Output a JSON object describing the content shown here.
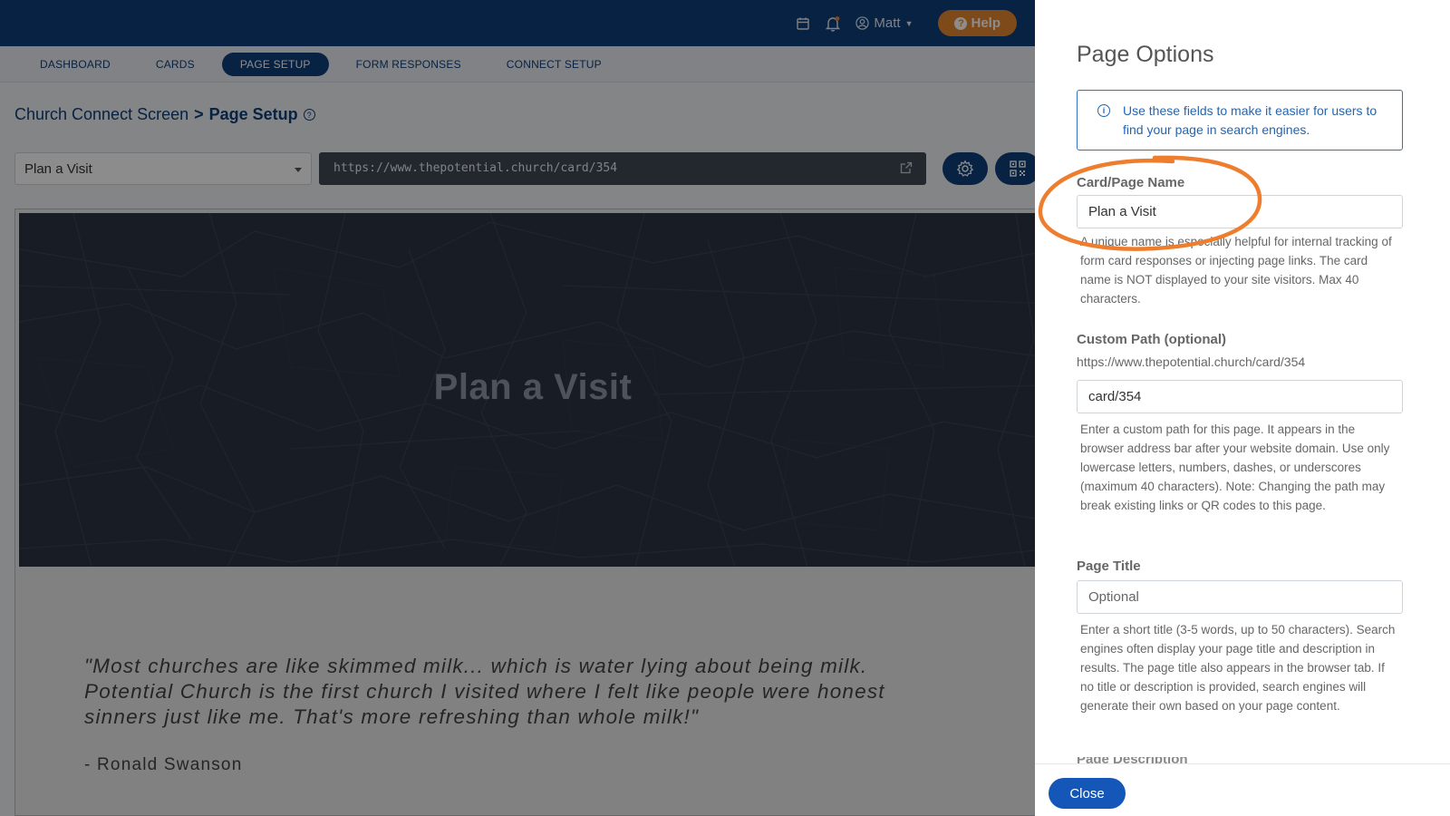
{
  "topbar": {
    "user_name": "Matt",
    "help_label": "Help"
  },
  "nav": {
    "items": [
      "DASHBOARD",
      "CARDS",
      "PAGE SETUP",
      "FORM RESPONSES",
      "CONNECT SETUP"
    ],
    "active": "PAGE SETUP"
  },
  "breadcrumb": {
    "parent": "Church Connect Screen",
    "separator": ">",
    "current": "Page Setup"
  },
  "toolbar": {
    "page_select_value": "Plan a Visit",
    "url": "https://www.thepotential.church/card/354"
  },
  "preview": {
    "hero_title": "Plan a Visit",
    "quote": "\"Most churches are like skimmed milk... which is water lying about being milk. Potential Church is the first church I visited where I felt like people were honest sinners just like me. That's more refreshing than whole milk!\"",
    "author": "- Ronald Swanson"
  },
  "panel": {
    "title": "Page Options",
    "notice": "Use these fields to make it easier for users to find your page in search engines.",
    "name_label": "Card/Page Name",
    "name_value": "Plan a Visit",
    "name_help": "A unique name is especially helpful for internal tracking of form card responses or injecting page links. The card name is NOT displayed to your site visitors. Max 40 characters.",
    "path_label": "Custom Path (optional)",
    "path_url": "https://www.thepotential.church/card/354",
    "path_value": "card/354",
    "path_help": "Enter a custom path for this page. It appears in the browser address bar after your website domain. Use only lowercase letters, numbers, dashes, or underscores (maximum 40 characters). Note: Changing the path may break existing links or QR codes to this page.",
    "title_label": "Page Title",
    "title_placeholder": "Optional",
    "title_help": "Enter a short title (3-5 words, up to 50 characters). Search engines often display your page title and description in results. The page title also appears in the browser tab. If no title or description is provided, search engines will generate their own based on your page content.",
    "next_label": "Page Description",
    "close_label": "Close"
  },
  "colors": {
    "brand_blue": "#0f3f7a",
    "help_orange": "#e6872f",
    "close_blue": "#1457b8",
    "highlight_orange": "#ee7d2e"
  }
}
